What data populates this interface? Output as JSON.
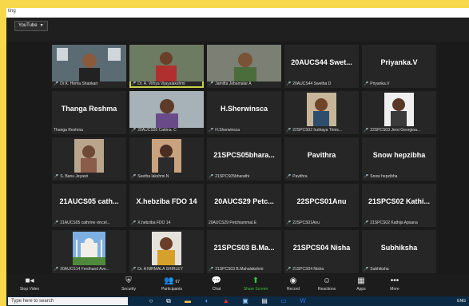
{
  "window": {
    "title": "ting",
    "youtube_label": "YouTube"
  },
  "tiles": [
    {
      "big": "",
      "cap": "Dr.K. Hema Shankari"
    },
    {
      "big": "",
      "cap": "Dr. A. Vithya Vijayalakshmi",
      "active": true
    },
    {
      "big": "",
      "cap": "Jamitta Jebamalar A"
    },
    {
      "big": "20AUCS44 Swet...",
      "cap": "20AUCS44 Swetha D"
    },
    {
      "big": "Priyanka.V",
      "cap": "Priyanka.V"
    },
    {
      "big": "Thanga Reshma",
      "cap": "Thanga Reshma",
      "nomic": true
    },
    {
      "big": "",
      "cap": "20AUCS55 Cattina. C"
    },
    {
      "big": "H.Sherwinsca",
      "cap": "H.Sherwinsca"
    },
    {
      "big": "",
      "cap": "22SPCS02 Iruthaya Trinis..."
    },
    {
      "big": "",
      "cap": "22SPCS03 Jersi Georgina..."
    },
    {
      "big": "",
      "cap": "S. Banu Jeyasri"
    },
    {
      "big": "",
      "cap": "Seetha lakshmi.N"
    },
    {
      "big": "21SPCS05bhara...",
      "cap": "21SPCS05bharathi"
    },
    {
      "big": "Pavithra",
      "cap": "Pavithra"
    },
    {
      "big": "Snow hepzibha",
      "cap": "Snow hepzibha"
    },
    {
      "big": "21AUCS05 cath...",
      "cap": "21AUCS05 cathrine vincel..."
    },
    {
      "big": "X.hebziba FDO 14",
      "cap": "X.hebziba FDO 14"
    },
    {
      "big": "20AUCS29 Petc...",
      "cap": "20AUCS29 Petchiammal.E",
      "nomic": true
    },
    {
      "big": "22SPCS01Anu",
      "cap": "22SPCS01Anu"
    },
    {
      "big": "21SPCS02 Kathi...",
      "cap": "21SPCS02 Kathija Apsana"
    },
    {
      "big": "",
      "cap": "20AUCS14 Ferdhand Ave..."
    },
    {
      "big": "",
      "cap": "Dr. A NIRMALA SHIRLEY"
    },
    {
      "big": "21SPCS03 B.Ma...",
      "cap": "21SPCS03 B.Mahalakshmi"
    },
    {
      "big": "21SPCS04 Nisha",
      "cap": "21SPCS04 Nisha"
    },
    {
      "big": "Subhiksha",
      "cap": "Subhiksha"
    }
  ],
  "toolbar": {
    "stop_video": "Stop Video",
    "security": "Security",
    "participants": "Participants",
    "participants_count": "67",
    "chat": "Chat",
    "share_screen": "Share Screen",
    "record": "Record",
    "reactions": "Reactions",
    "apps": "Apps",
    "more": "More"
  },
  "taskbar": {
    "search_placeholder": "Type here to search",
    "lang": "ENG"
  }
}
